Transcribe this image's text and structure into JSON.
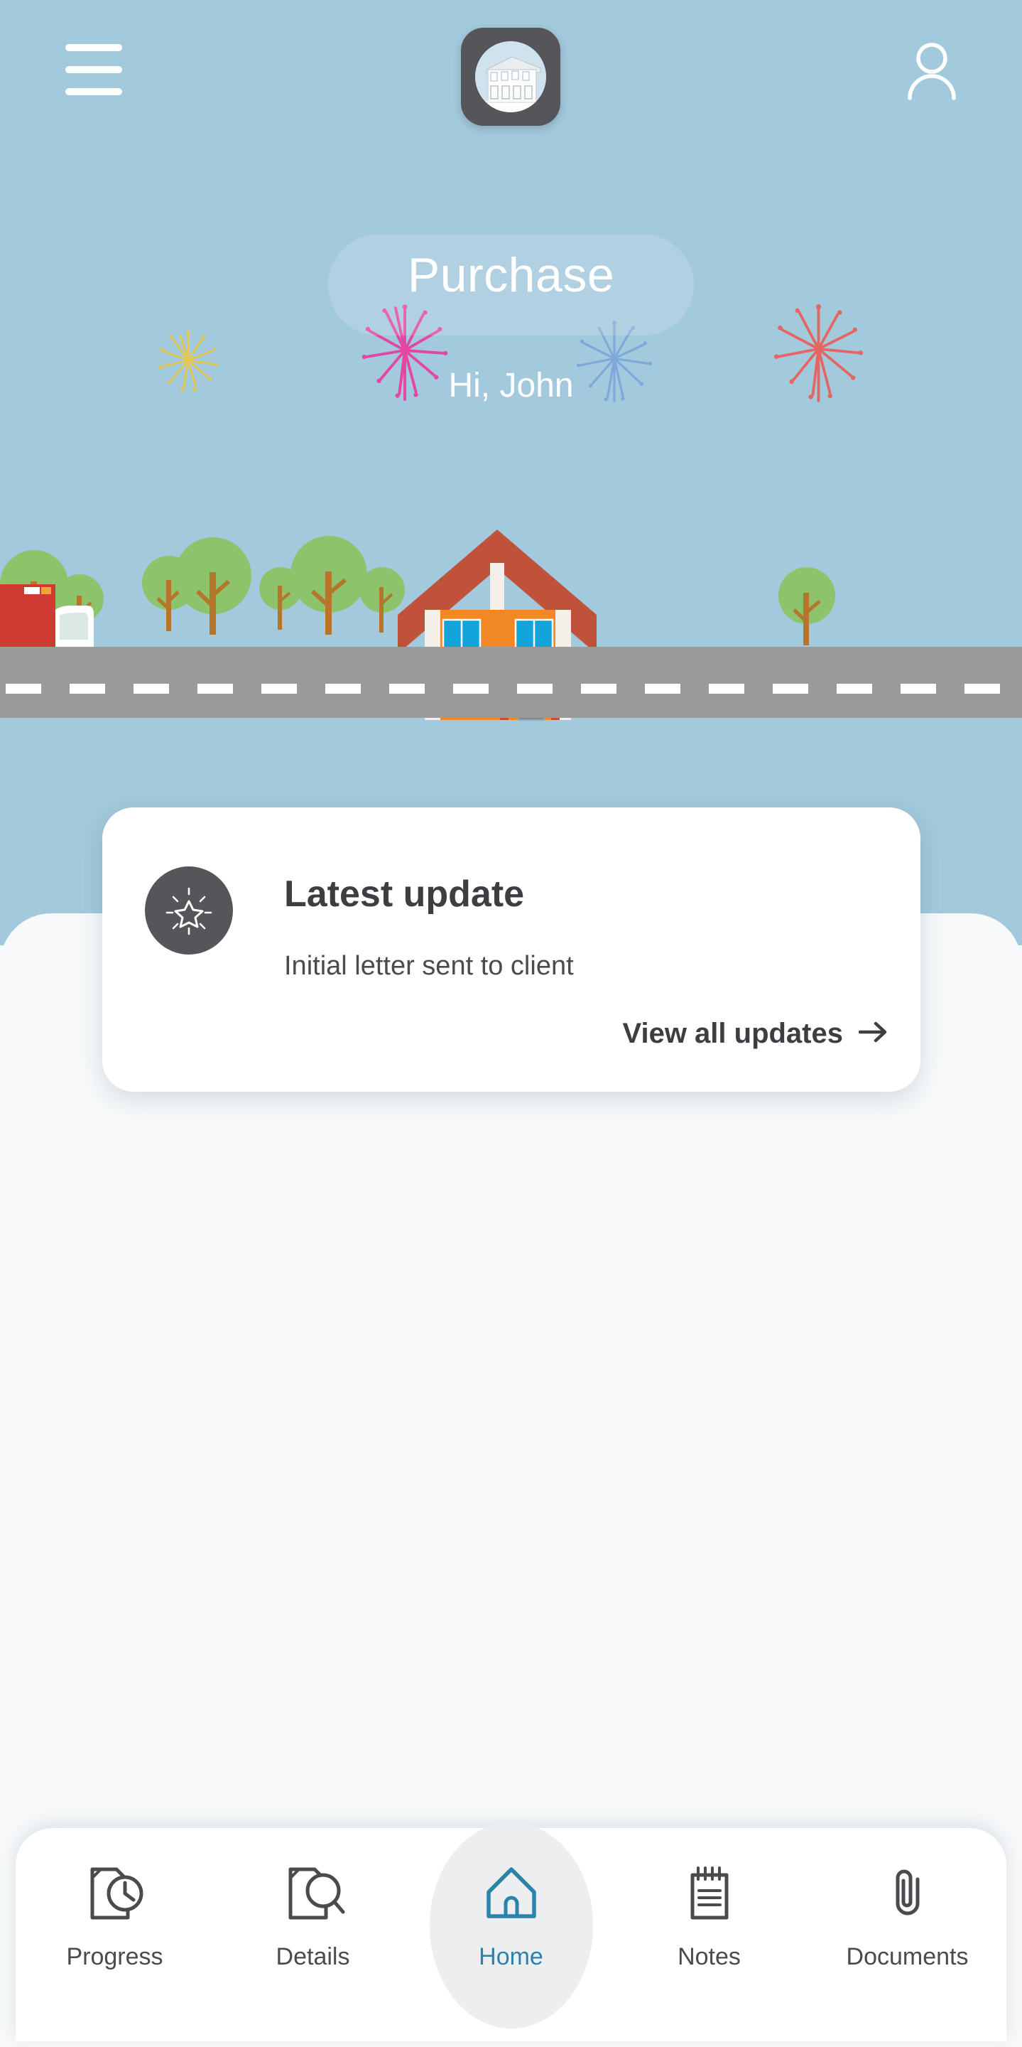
{
  "app": {
    "brand_logo_alt": "property-house-logo",
    "background_color": "#a3c9dd",
    "body_background_color": "#f7f9fa",
    "accent_color": "#2a83ab"
  },
  "header": {
    "menu_icon": "hamburger-menu-icon",
    "logo_icon": "house-brand-logo-icon",
    "profile_icon": "user-account-icon"
  },
  "hero": {
    "case_type": "Purchase",
    "greeting": "Hi, John",
    "fireworks": [
      {
        "name": "firework-yellow",
        "color": "#e8c84a"
      },
      {
        "name": "firework-pink",
        "color": "#e83fa0"
      },
      {
        "name": "firework-blue",
        "color": "#7ba7d9"
      },
      {
        "name": "firework-red",
        "color": "#e8615c"
      }
    ],
    "scene": {
      "sky_color": "#a3c9dd",
      "road_color": "#9a9a9a",
      "road_marking_color": "#ffffff",
      "tree_canopy_color": "#8cc36b",
      "tree_trunk_color": "#b5762c",
      "truck_body_color": "#cf3b32",
      "truck_cab_color": "#ffffff",
      "house_wall_color": "#f18825",
      "house_roof_color": "#c0523c",
      "house_window_color": "#11a4db",
      "house_door_color": "#7b8b96"
    }
  },
  "update_card": {
    "icon": "sparkle-star-icon",
    "title": "Latest update",
    "subtitle": "Initial letter sent to client",
    "link_label": "View all updates",
    "link_icon": "arrow-right-icon"
  },
  "bottom_nav": {
    "items": [
      {
        "id": "progress",
        "label": "Progress",
        "icon": "document-clock-icon",
        "active": false
      },
      {
        "id": "details",
        "label": "Details",
        "icon": "document-magnifier-icon",
        "active": false
      },
      {
        "id": "home",
        "label": "Home",
        "icon": "house-icon",
        "active": true
      },
      {
        "id": "notes",
        "label": "Notes",
        "icon": "notepad-icon",
        "active": false
      },
      {
        "id": "documents",
        "label": "Documents",
        "icon": "paperclip-icon",
        "active": false
      }
    ]
  }
}
